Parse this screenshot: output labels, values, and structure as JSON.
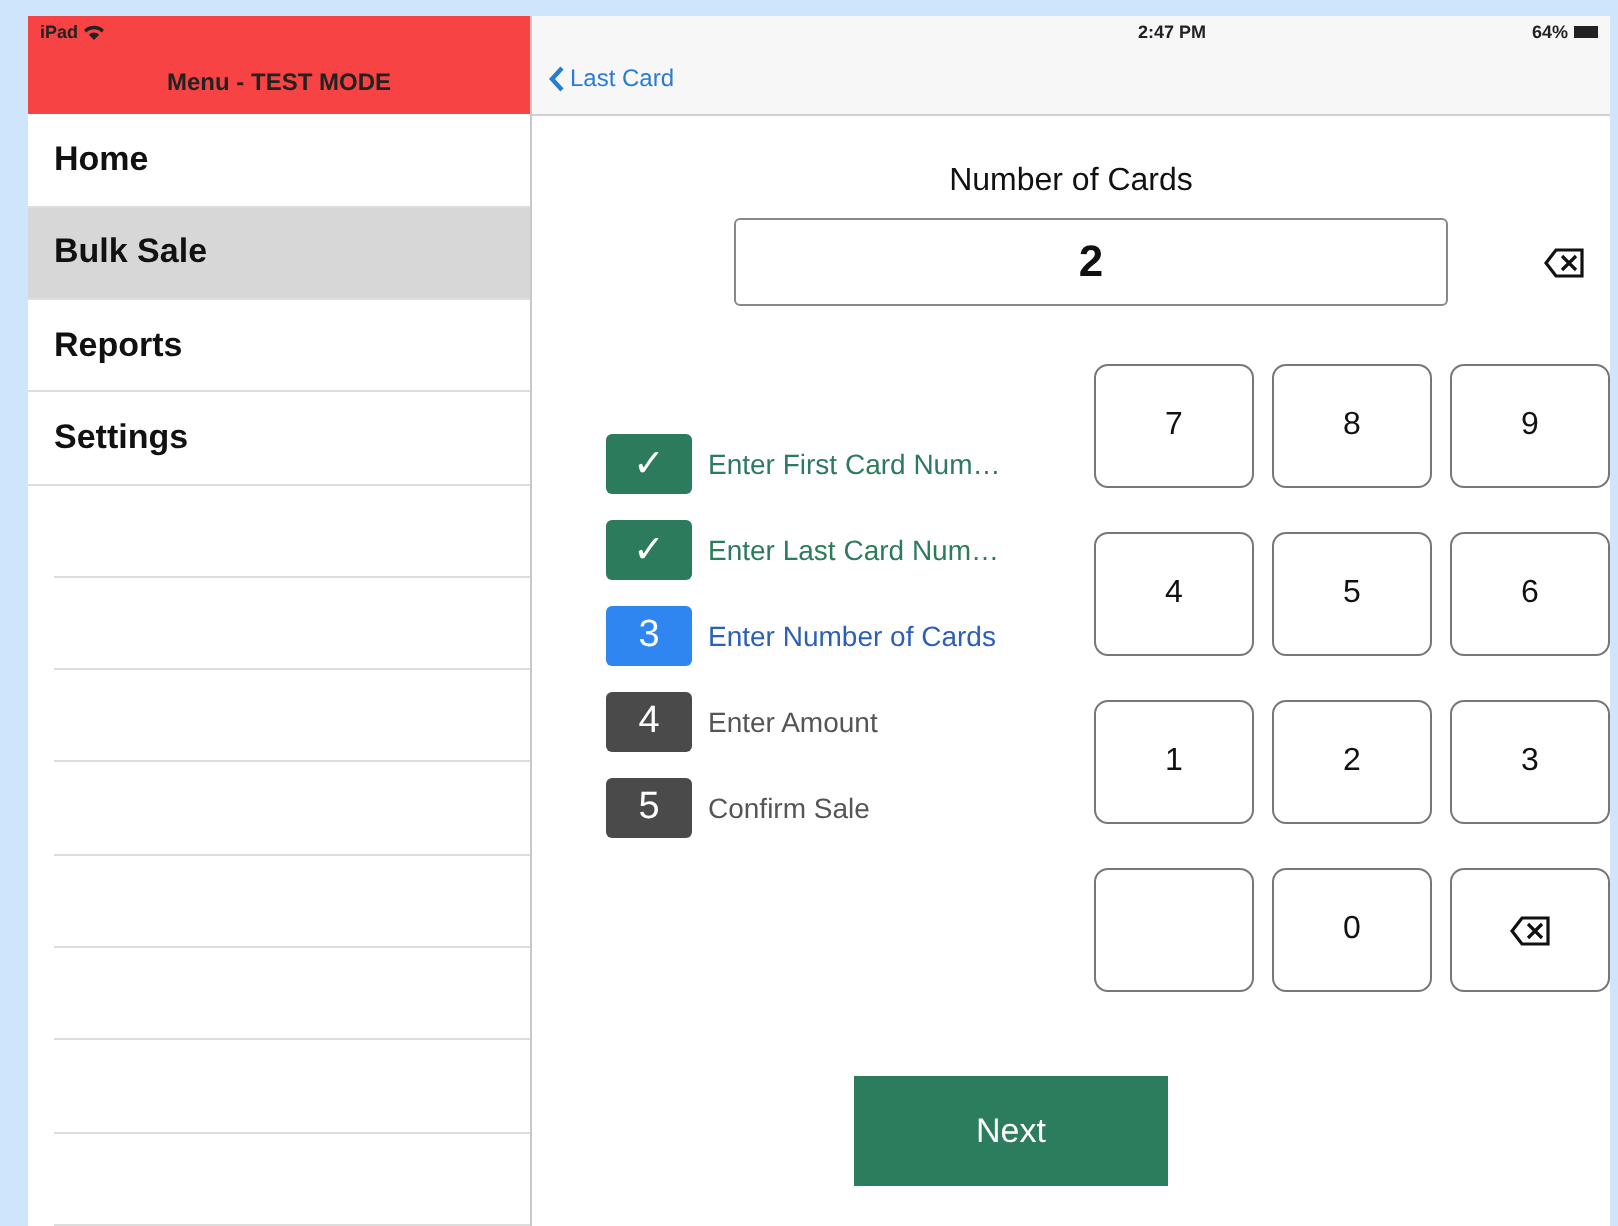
{
  "status_bar": {
    "device": "iPad",
    "time": "2:47 PM",
    "battery": "64%"
  },
  "sidebar": {
    "title": "Menu - TEST MODE",
    "items": [
      {
        "label": "Home",
        "selected": false
      },
      {
        "label": "Bulk Sale",
        "selected": true
      },
      {
        "label": "Reports",
        "selected": false
      },
      {
        "label": "Settings",
        "selected": false
      }
    ]
  },
  "nav": {
    "back": "Last Card"
  },
  "entry": {
    "title": "Number of Cards",
    "value": "2"
  },
  "steps": [
    {
      "badge": "✓",
      "label": "Enter First Card Num…",
      "kind": "done"
    },
    {
      "badge": "✓",
      "label": "Enter Last Card Num…",
      "kind": "done"
    },
    {
      "badge": "3",
      "label": "Enter Number of Cards",
      "kind": "current"
    },
    {
      "badge": "4",
      "label": "Enter Amount",
      "kind": "pending"
    },
    {
      "badge": "5",
      "label": "Confirm Sale",
      "kind": "pending"
    }
  ],
  "keypad": [
    {
      "kind": "digit",
      "label": "7"
    },
    {
      "kind": "digit",
      "label": "8"
    },
    {
      "kind": "digit",
      "label": "9"
    },
    {
      "kind": "digit",
      "label": "4"
    },
    {
      "kind": "digit",
      "label": "5"
    },
    {
      "kind": "digit",
      "label": "6"
    },
    {
      "kind": "digit",
      "label": "1"
    },
    {
      "kind": "digit",
      "label": "2"
    },
    {
      "kind": "digit",
      "label": "3"
    },
    {
      "kind": "blank"
    },
    {
      "kind": "digit",
      "label": "0"
    },
    {
      "kind": "backspace"
    }
  ],
  "next_button": "Next"
}
